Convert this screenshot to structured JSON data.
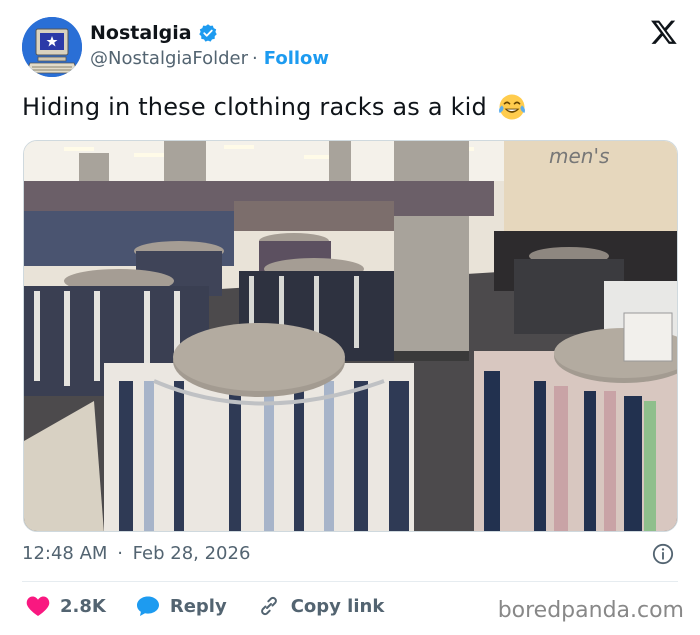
{
  "account": {
    "name": "Nostalgia",
    "handle": "@NostalgiaFolder",
    "separator": "·",
    "follow_label": "Follow"
  },
  "tweet": {
    "text": "Hiding in these clothing racks as a kid",
    "emoji": "face-with-tears-of-joy",
    "photo_sign": "men's"
  },
  "meta": {
    "time": "12:48 AM",
    "date_sep": "·",
    "date": "Feb 28, 2026"
  },
  "actions": {
    "likes": "2.8K",
    "reply_label": "Reply",
    "copy_label": "Copy link"
  },
  "watermark": "boredpanda.com",
  "colors": {
    "accent": "#1d9bf0",
    "like": "#f91880",
    "muted": "#536471"
  }
}
